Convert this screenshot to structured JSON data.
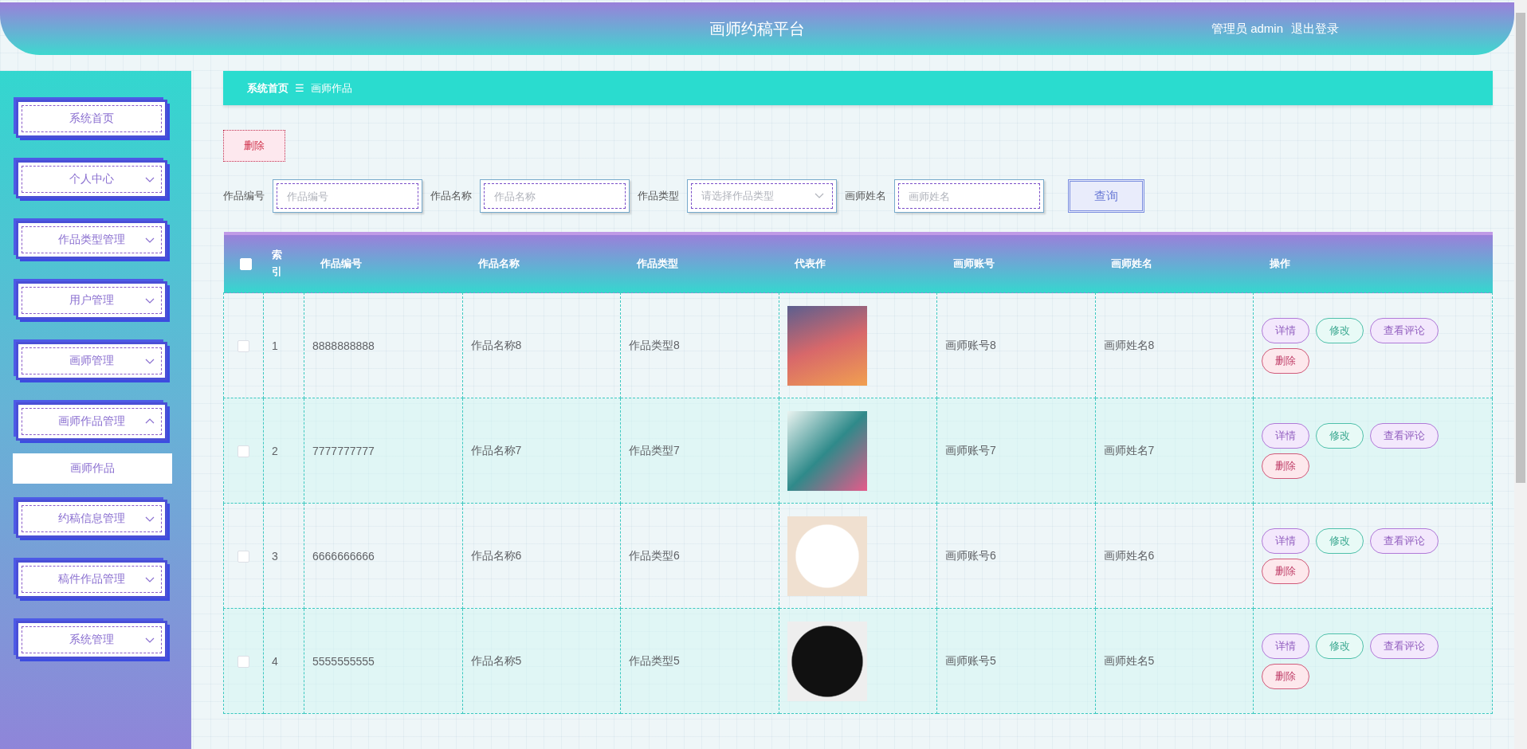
{
  "header": {
    "title": "画师约稿平台",
    "user": "管理员 admin",
    "logout": "退出登录"
  },
  "sidebar": {
    "items": [
      {
        "label": "系统首页",
        "expandable": false
      },
      {
        "label": "个人中心",
        "expandable": true,
        "expanded": false
      },
      {
        "label": "作品类型管理",
        "expandable": true,
        "expanded": false
      },
      {
        "label": "用户管理",
        "expandable": true,
        "expanded": false
      },
      {
        "label": "画师管理",
        "expandable": true,
        "expanded": false
      },
      {
        "label": "画师作品管理",
        "expandable": true,
        "expanded": true,
        "children": [
          {
            "label": "画师作品"
          }
        ]
      },
      {
        "label": "约稿信息管理",
        "expandable": true,
        "expanded": false
      },
      {
        "label": "稿件作品管理",
        "expandable": true,
        "expanded": false
      },
      {
        "label": "系统管理",
        "expandable": true,
        "expanded": false
      }
    ]
  },
  "breadcrumb": {
    "home": "系统首页",
    "separator": "☰",
    "current": "画师作品"
  },
  "toolbar": {
    "delete": "删除"
  },
  "filters": [
    {
      "kind": "input",
      "label": "作品编号",
      "placeholder": "作品编号"
    },
    {
      "kind": "input",
      "label": "作品名称",
      "placeholder": "作品名称"
    },
    {
      "kind": "select",
      "label": "作品类型",
      "placeholder": "请选择作品类型"
    },
    {
      "kind": "input",
      "label": "画师姓名",
      "placeholder": "画师姓名"
    }
  ],
  "search_button": "查询",
  "table": {
    "select_all_checked": false,
    "columns": [
      "索引",
      "作品编号",
      "作品名称",
      "作品类型",
      "代表作",
      "画师账号",
      "画师姓名",
      "操作"
    ],
    "rows": [
      {
        "checked": false,
        "index": "1",
        "code": "8888888888",
        "name": "作品名称8",
        "type": "作品类型8",
        "account": "画师账号8",
        "artist": "画师姓名8",
        "actions": [
          {
            "kind": "detail",
            "label": "详情"
          },
          {
            "kind": "edit",
            "label": "修改"
          },
          {
            "kind": "comments",
            "label": "查看评论"
          },
          {
            "kind": "delete",
            "label": "删除"
          }
        ]
      },
      {
        "checked": false,
        "index": "2",
        "code": "7777777777",
        "name": "作品名称7",
        "type": "作品类型7",
        "account": "画师账号7",
        "artist": "画师姓名7",
        "actions": [
          {
            "kind": "detail",
            "label": "详情"
          },
          {
            "kind": "edit",
            "label": "修改"
          },
          {
            "kind": "comments",
            "label": "查看评论"
          },
          {
            "kind": "delete",
            "label": "删除"
          }
        ]
      },
      {
        "checked": false,
        "index": "3",
        "code": "6666666666",
        "name": "作品名称6",
        "type": "作品类型6",
        "account": "画师账号6",
        "artist": "画师姓名6",
        "actions": [
          {
            "kind": "detail",
            "label": "详情"
          },
          {
            "kind": "edit",
            "label": "修改"
          },
          {
            "kind": "comments",
            "label": "查看评论"
          },
          {
            "kind": "delete",
            "label": "删除"
          }
        ]
      },
      {
        "checked": false,
        "index": "4",
        "code": "5555555555",
        "name": "作品名称5",
        "type": "作品类型5",
        "account": "画师账号5",
        "artist": "画师姓名5",
        "actions": [
          {
            "kind": "detail",
            "label": "详情"
          },
          {
            "kind": "edit",
            "label": "修改"
          },
          {
            "kind": "comments",
            "label": "查看评论"
          },
          {
            "kind": "delete",
            "label": "删除"
          }
        ]
      }
    ]
  }
}
